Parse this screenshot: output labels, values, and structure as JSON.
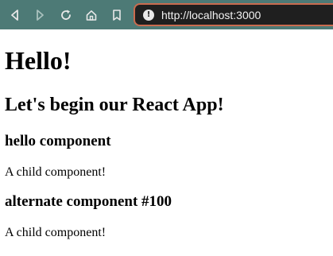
{
  "browser": {
    "url": "http://localhost:3000",
    "icons": [
      "back-icon",
      "forward-icon",
      "reload-icon",
      "home-icon",
      "bookmark-icon",
      "site-info-icon"
    ]
  },
  "page": {
    "heading": "Hello!",
    "subheading": "Let's begin our React App!",
    "components": [
      {
        "title": "hello component",
        "text": "A child component!"
      },
      {
        "title": "alternate component #100",
        "text": "A child component!"
      }
    ]
  },
  "colors": {
    "toolbar_bg": "#4d7a76",
    "url_bar_bg": "#1f1f1f",
    "url_bar_border": "#c96b4f",
    "page_bg": "#ffffff"
  }
}
